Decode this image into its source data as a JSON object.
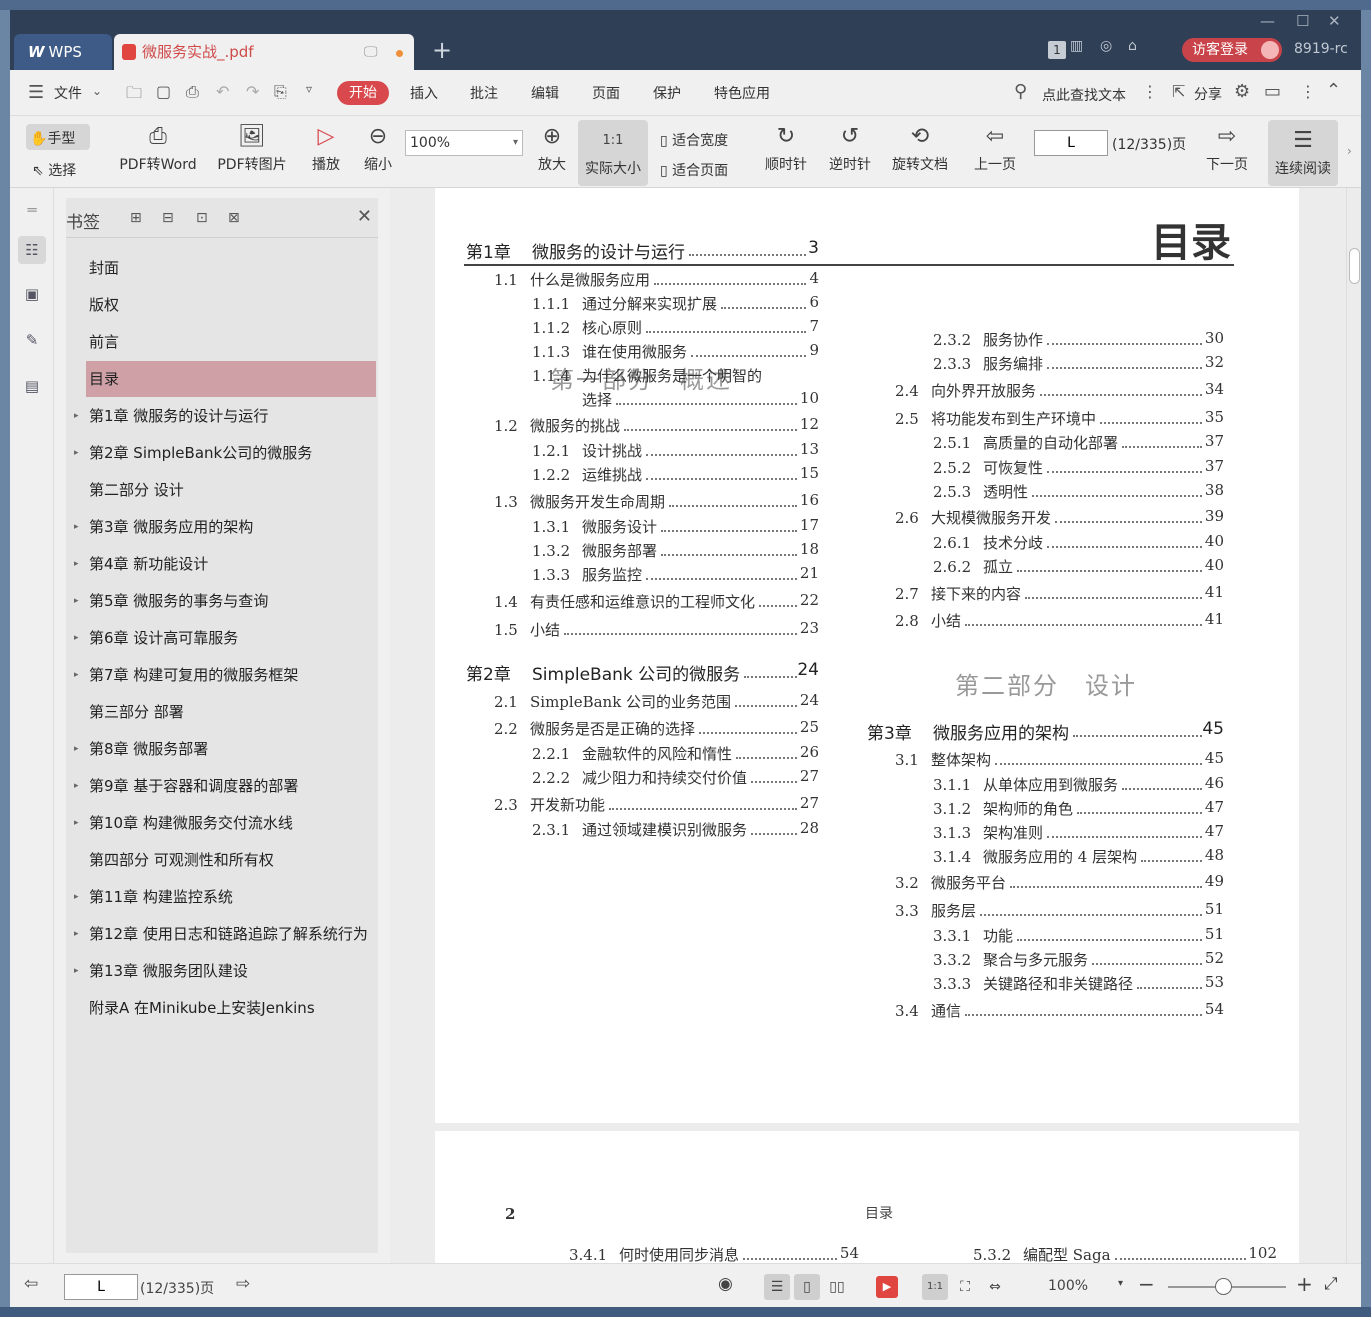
{
  "titlebar": {
    "app_tab": "WPS",
    "doc_tab": "微服务实战_.pdf",
    "page_badge": "1",
    "login": "访客登录",
    "user_id": "8919-rc"
  },
  "menu": {
    "file": "文件",
    "start": "开始",
    "insert": "插入",
    "comment": "批注",
    "edit": "编辑",
    "page": "页面",
    "protect": "保护",
    "special": "特色应用",
    "search": "点此查找文本",
    "share": "分享"
  },
  "toolbar": {
    "hand": "手型",
    "select": "选择",
    "pdf2word": "PDF转Word",
    "pdf2img": "PDF转图片",
    "play": "播放",
    "zoom_out": "缩小",
    "zoom": "100%",
    "zoom_in": "放大",
    "actual": "实际大小",
    "fit_width": "适合宽度",
    "fit_page": "适合页面",
    "cw": "顺时针",
    "ccw": "逆时针",
    "rotate": "旋转文档",
    "prev": "上一页",
    "page_input": "L",
    "page_total": "(12/335)页",
    "next": "下一页",
    "continuous": "连续阅读"
  },
  "panel": {
    "title": "书签",
    "items": [
      {
        "label": "封面",
        "arrow": ""
      },
      {
        "label": "版权",
        "arrow": ""
      },
      {
        "label": "前言",
        "arrow": ""
      },
      {
        "label": "目录",
        "arrow": ""
      },
      {
        "label": "第1章 微服务的设计与运行",
        "arrow": "▸"
      },
      {
        "label": "第2章 SimpleBank公司的微服务",
        "arrow": "▸"
      },
      {
        "label": "第二部分 设计",
        "arrow": ""
      },
      {
        "label": "第3章 微服务应用的架构",
        "arrow": "▸"
      },
      {
        "label": "第4章 新功能设计",
        "arrow": "▸"
      },
      {
        "label": "第5章 微服务的事务与查询",
        "arrow": "▸"
      },
      {
        "label": "第6章 设计高可靠服务",
        "arrow": "▸"
      },
      {
        "label": "第7章 构建可复用的微服务框架",
        "arrow": "▸"
      },
      {
        "label": "第三部分 部署",
        "arrow": ""
      },
      {
        "label": "第8章 微服务部署",
        "arrow": "▸"
      },
      {
        "label": "第9章 基于容器和调度器的部署",
        "arrow": "▸"
      },
      {
        "label": "第10章 构建微服务交付流水线",
        "arrow": "▸"
      },
      {
        "label": "第四部分 可观测性和所有权",
        "arrow": ""
      },
      {
        "label": "第11章 构建监控系统",
        "arrow": "▸"
      },
      {
        "label": "第12章 使用日志和链路追踪了解系统行为",
        "arrow": "▸"
      },
      {
        "label": "第13章 微服务团队建设",
        "arrow": "▸"
      },
      {
        "label": "附录A 在Minikube上安装Jenkins",
        "arrow": ""
      }
    ]
  },
  "doc": {
    "page_title": "目录",
    "part1": "第一部分　概述",
    "part2": "第二部分　设计",
    "left": [
      [
        "第1章",
        "微服务的设计与运行",
        "3",
        1
      ],
      [
        "1.1",
        "什么是微服务应用",
        "4",
        2
      ],
      [
        "1.1.1",
        "通过分解来实现扩展",
        "6",
        3
      ],
      [
        "1.1.2",
        "核心原则",
        "7",
        3
      ],
      [
        "1.1.3",
        "谁在使用微服务",
        "9",
        3
      ],
      [
        "1.1.4",
        "为什么微服务是一个明智的",
        "",
        3
      ],
      [
        "",
        "选择",
        "10",
        4
      ],
      [
        "1.2",
        "微服务的挑战",
        "12",
        2
      ],
      [
        "1.2.1",
        "设计挑战",
        "13",
        3
      ],
      [
        "1.2.2",
        "运维挑战",
        "15",
        3
      ],
      [
        "1.3",
        "微服务开发生命周期",
        "16",
        2
      ],
      [
        "1.3.1",
        "微服务设计",
        "17",
        3
      ],
      [
        "1.3.2",
        "微服务部署",
        "18",
        3
      ],
      [
        "1.3.3",
        "服务监控",
        "21",
        3
      ],
      [
        "1.4",
        "有责任感和运维意识的工程师文化",
        "22",
        2
      ],
      [
        "1.5",
        "小结",
        "23",
        2
      ],
      [
        "第2章",
        "SimpleBank 公司的微服务",
        "24",
        1
      ],
      [
        "2.1",
        "SimpleBank 公司的业务范围",
        "24",
        2
      ],
      [
        "2.2",
        "微服务是否是正确的选择",
        "25",
        2
      ],
      [
        "2.2.1",
        "金融软件的风险和惰性",
        "26",
        3
      ],
      [
        "2.2.2",
        "减少阻力和持续交付价值",
        "27",
        3
      ],
      [
        "2.3",
        "开发新功能",
        "27",
        2
      ],
      [
        "2.3.1",
        "通过领域建模识别微服务",
        "28",
        3
      ]
    ],
    "right": [
      [
        "2.3.2",
        "服务协作",
        "30",
        3
      ],
      [
        "2.3.3",
        "服务编排",
        "32",
        3
      ],
      [
        "2.4",
        "向外界开放服务",
        "34",
        2
      ],
      [
        "2.5",
        "将功能发布到生产环境中",
        "35",
        2
      ],
      [
        "2.5.1",
        "高质量的自动化部署",
        "37",
        3
      ],
      [
        "2.5.2",
        "可恢复性",
        "37",
        3
      ],
      [
        "2.5.3",
        "透明性",
        "38",
        3
      ],
      [
        "2.6",
        "大规模微服务开发",
        "39",
        2
      ],
      [
        "2.6.1",
        "技术分歧",
        "40",
        3
      ],
      [
        "2.6.2",
        "孤立",
        "40",
        3
      ],
      [
        "2.7",
        "接下来的内容",
        "41",
        2
      ],
      [
        "2.8",
        "小结",
        "41",
        2
      ],
      [
        "第3章",
        "微服务应用的架构",
        "45",
        1
      ],
      [
        "3.1",
        "整体架构",
        "45",
        2
      ],
      [
        "3.1.1",
        "从单体应用到微服务",
        "46",
        3
      ],
      [
        "3.1.2",
        "架构师的角色",
        "47",
        3
      ],
      [
        "3.1.3",
        "架构准则",
        "47",
        3
      ],
      [
        "3.1.4",
        "微服务应用的 4 层架构",
        "48",
        3
      ],
      [
        "3.2",
        "微服务平台",
        "49",
        2
      ],
      [
        "3.3",
        "服务层",
        "51",
        2
      ],
      [
        "3.3.1",
        "功能",
        "51",
        3
      ],
      [
        "3.3.2",
        "聚合与多元服务",
        "52",
        3
      ],
      [
        "3.3.3",
        "关键路径和非关键路径",
        "53",
        3
      ],
      [
        "3.4",
        "通信",
        "54",
        2
      ]
    ],
    "page2_num": "2",
    "page2_header": "目录",
    "page2_left": [
      "3.4.1",
      "何时使用同步消息",
      "54"
    ],
    "page2_right": [
      "5.3.2",
      "编配型 Saga",
      "102"
    ]
  },
  "status": {
    "page_input": "L",
    "page_total": "(12/335)页",
    "zoom": "100%"
  }
}
